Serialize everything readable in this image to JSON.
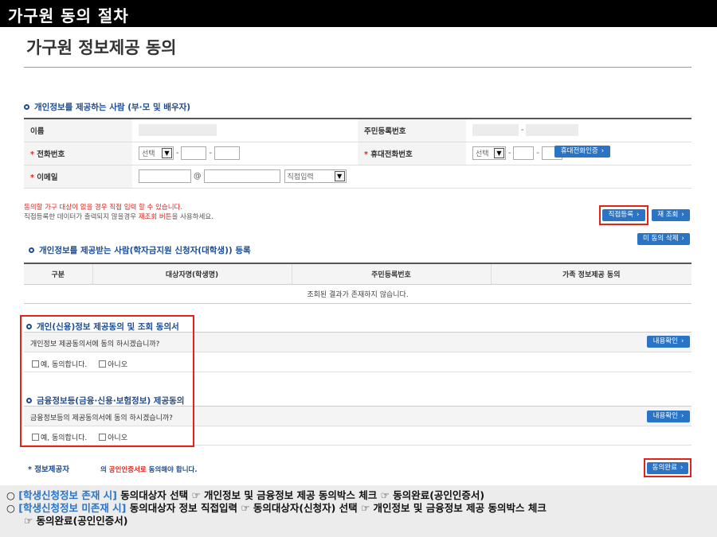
{
  "banner": {
    "title": "가구원 동의 절차"
  },
  "page": {
    "title": "가구원 정보제공 동의"
  },
  "section_provider": {
    "heading": "개인정보를 제공하는 사람 (부·모 및 배우자)",
    "name_label": "이름",
    "rrn_label": "주민등록번호",
    "phone_label": "전화번호",
    "mobile_label": "휴대전화번호",
    "email_label": "이메일",
    "select_placeholder": "선택",
    "email_domain_placeholder": "직접입력",
    "at_sign": "@",
    "dash": "-",
    "mobile_verify_button": "휴대전화인증"
  },
  "notes": {
    "red": "동의할 가구 대상이 없을 경우 직접 입력 할 수 있습니다.",
    "gray_prefix": "직접등록한 데이터가 출력되지 않을경우 ",
    "gray_highlight": "재조회 버튼",
    "gray_suffix": "을 사용하세요."
  },
  "buttons": {
    "direct_register": "직접등록",
    "re_lookup": "재 조회",
    "delete_unconsented": "미 동의 삭제",
    "view_content_1": "내용확인",
    "view_content_2": "내용확인",
    "complete_consent": "동의완료"
  },
  "section_receiver": {
    "heading": "개인정보를 제공받는 사람(학자금지원 신청자(대학생)) 등록",
    "columns": [
      "구분",
      "대상자명(학생명)",
      "주민등록번호",
      "가족 정보제공 동의"
    ],
    "empty_message": "조회된 결과가 존재하지 않습니다."
  },
  "consent_personal": {
    "heading": "개인(신용)정보 제공동의 및 조회 동의서",
    "question": "개인정보 제공동의서에 동의 하시겠습니까?",
    "yes": "예, 동의합니다.",
    "no": "아니오"
  },
  "consent_financial": {
    "heading": "금융정보등(금융·신용·보험정보) 제공동의",
    "question": "금융정보등의 제공동의서에 동의 하시겠습니까?",
    "yes": "예, 동의합니다.",
    "no": "아니오"
  },
  "provider": {
    "label": "* 정보제공자",
    "msg_prefix": "의 ",
    "msg_highlight": "공인인증서로",
    "msg_suffix": " 동의해야 합니다."
  },
  "bottom_info": {
    "line1_bullet": "○ ",
    "line1_highlight": "[학생신청정보 존재 시]",
    "line1_text": " 동의대상자 선택 ☞ 개인정보 및 금융정보 제공 동의박스 체크 ☞ 동의완료(공인인증서)",
    "line2_bullet": "○ ",
    "line2_highlight": "[학생신청정보 미존재 시]",
    "line2_text": " 동의대상자 정보 직접입력 ☞ 동의대상자(신청자) 선택 ☞ 개인정보 및 금융정보 제공 동의박스 체크",
    "line3_text": "☞ 동의완료(공인인증서)"
  },
  "colors": {
    "accent": "#2b74c5",
    "heading": "#1d4b8f",
    "alert": "#e2231a"
  }
}
